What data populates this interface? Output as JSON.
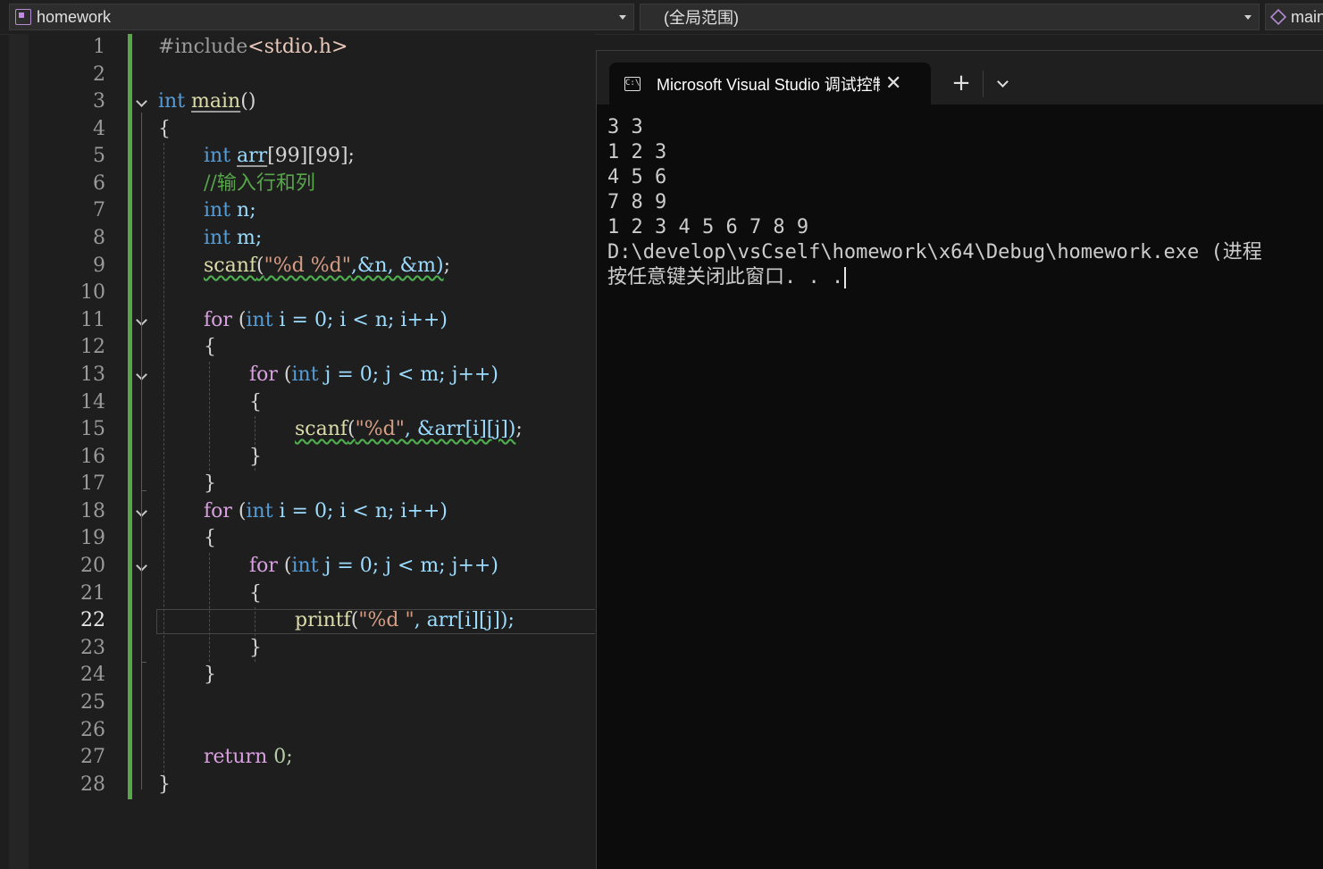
{
  "navbar": {
    "project": "homework",
    "scope": "(全局范围)",
    "member": "main"
  },
  "editor": {
    "active_line": 22,
    "line_numbers": [
      "1",
      "2",
      "3",
      "4",
      "5",
      "6",
      "7",
      "8",
      "9",
      "10",
      "11",
      "12",
      "13",
      "14",
      "15",
      "16",
      "17",
      "18",
      "19",
      "20",
      "21",
      "22",
      "23",
      "24",
      "25",
      "26",
      "27",
      "28"
    ],
    "code": {
      "l1_include": "#include",
      "l1_header": "<stdio.h>",
      "kw_int": "int",
      "l3_main": "main",
      "l3_parens": "()",
      "open_brace": "{",
      "close_brace": "}",
      "l5_arr": "arr",
      "l5_dims": "[99][99];",
      "l6_comment": "//输入行和列",
      "l7_rest": " n;",
      "l8_rest": " m;",
      "l9_scanf": "scanf",
      "l9_args_open": "(",
      "l9_fmt": "\"%d %d\"",
      "l9_args": ",&n, &m)",
      "semicolon": ";",
      "kw_for": "for",
      "for_i_open": " (",
      "for_i_rest": " i = 0; i < n; i++)",
      "for_j_rest": " j = 0; j < m; j++)",
      "l15_scanf": "scanf",
      "l15_fmt": "\"%d\"",
      "l15_args": ", &arr[i][j])",
      "l22_printf": "printf",
      "l22_fmt": "\"%d \"",
      "l22_args": ", arr[i][j]);",
      "kw_return": "return",
      "l27_rest": " 0;"
    }
  },
  "console": {
    "tab_title": "Microsoft Visual Studio 调试控制台",
    "new_tab": "+",
    "close_glyph": "✕",
    "lines": [
      "3 3",
      "1 2 3",
      "4 5 6",
      "7 8 9",
      "1 2 3 4 5 6 7 8 9",
      "D:\\develop\\vsCself\\homework\\x64\\Debug\\homework.exe (进程 ",
      "按任意键关闭此窗口. . ."
    ]
  }
}
